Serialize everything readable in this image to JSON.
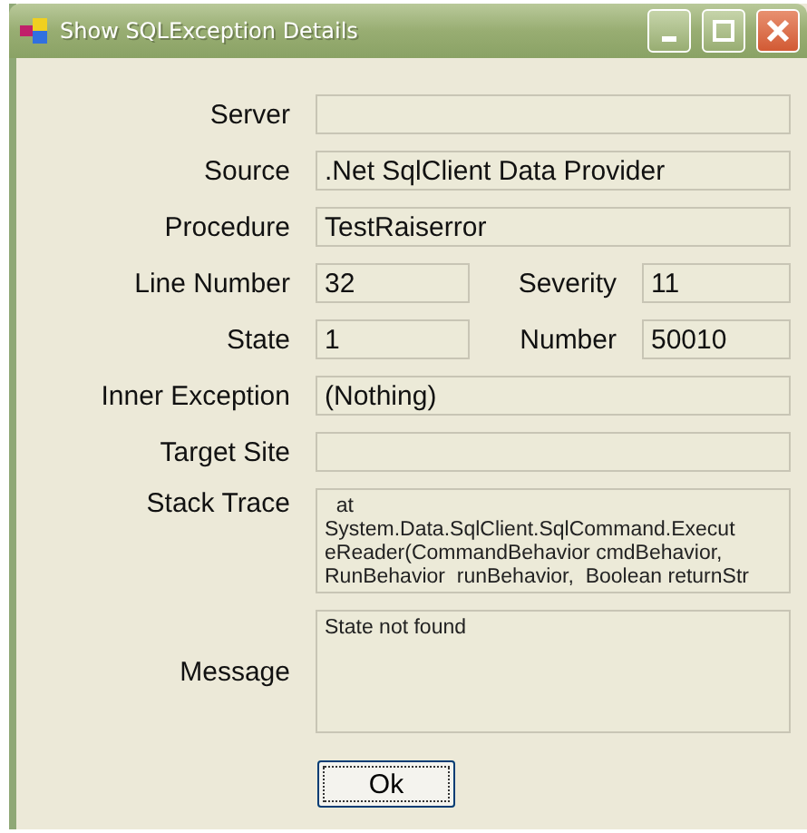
{
  "window": {
    "title": "Show SQLException Details"
  },
  "fields": [
    {
      "kind": "full",
      "label": "Server"
    },
    {
      "kind": "full",
      "label": "Source",
      "value": ".Net SqlClient Data Provider"
    },
    {
      "kind": "full",
      "label": "Procedure",
      "value": "TestRaiserror"
    },
    {
      "kind": "pair",
      "label": "Line Number",
      "value": "32",
      "label2": "Severity",
      "value2": "11"
    },
    {
      "kind": "pair",
      "label": "State",
      "value": "1",
      "label2": "Number",
      "value2": "50010"
    },
    {
      "kind": "full",
      "label": "Inner Exception",
      "value": "(Nothing)"
    },
    {
      "kind": "full",
      "label": "Target Site"
    },
    {
      "kind": "multi",
      "label": "Stack Trace",
      "lines": [
        "  at",
        "System.Data.SqlClient.SqlCommand.Execut",
        "eReader(CommandBehavior cmdBehavior,",
        "RunBehavior  runBehavior,  Boolean returnStr"
      ]
    },
    {
      "kind": "memo",
      "label": "Message",
      "lines": [
        "State not found"
      ]
    }
  ],
  "button": "Ok"
}
